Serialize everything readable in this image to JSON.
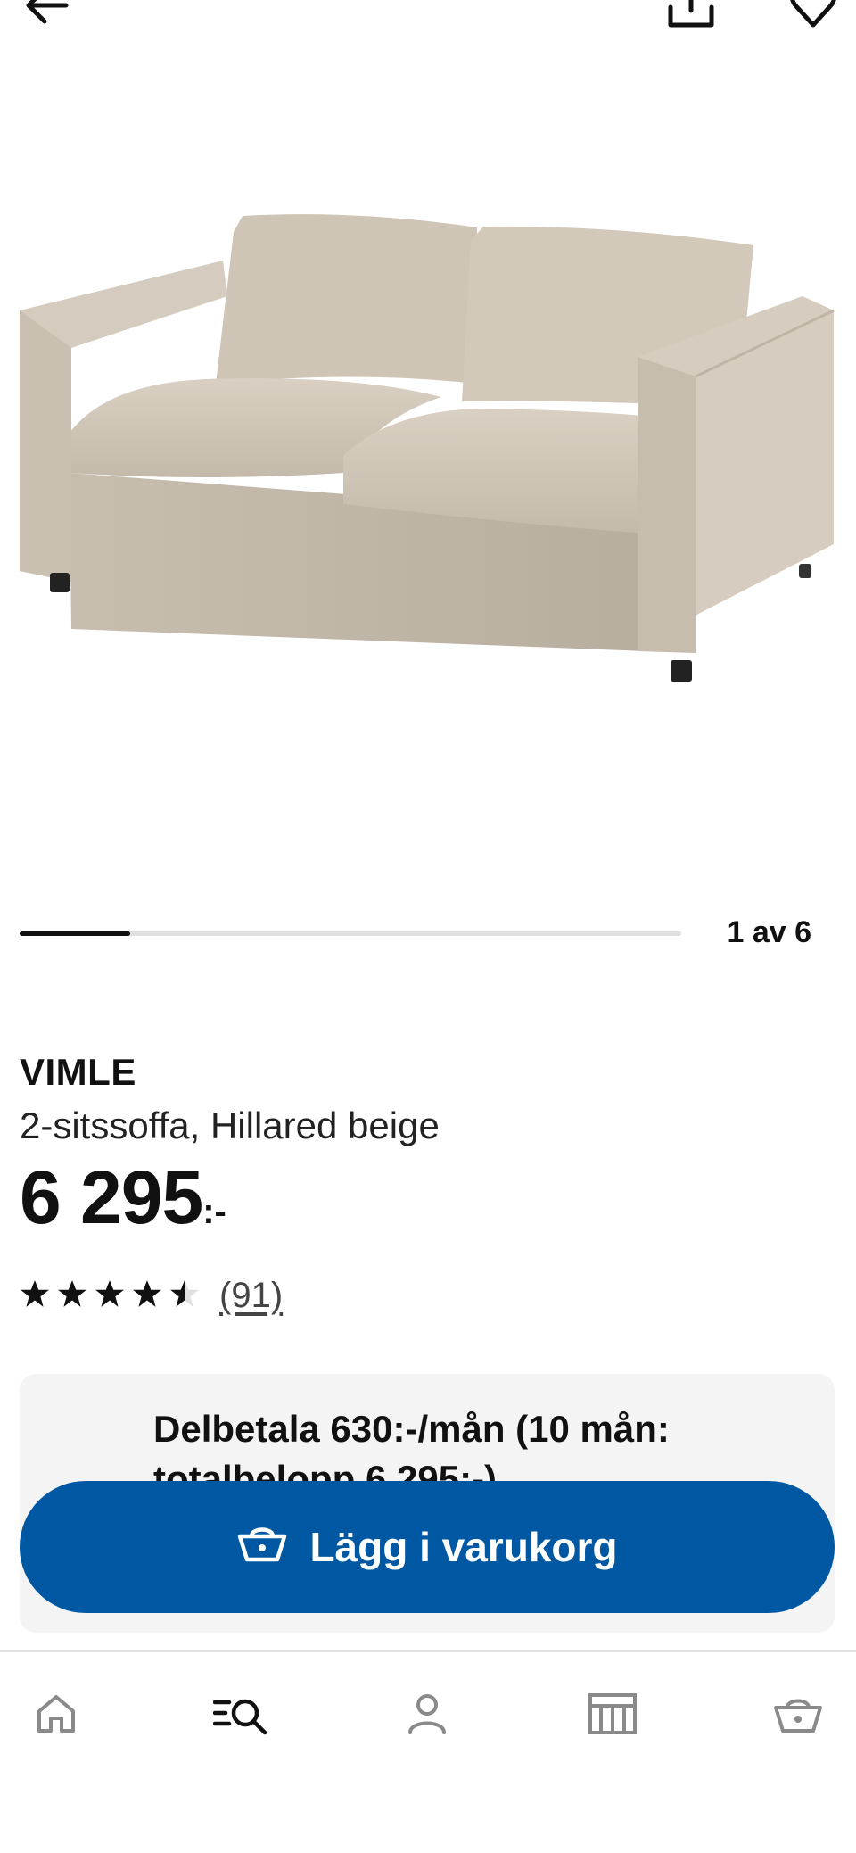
{
  "header": {
    "back_icon": "arrow-left-icon",
    "share_icon": "share-upload-icon",
    "favorite_icon": "heart-outline-icon"
  },
  "gallery": {
    "counter": "1 av 6",
    "current": 1,
    "total": 6,
    "image_alt": "2-sitssoffa"
  },
  "product": {
    "name": "VIMLE",
    "description": "2-sitssoffa, Hillared beige",
    "price": "6 295",
    "price_suffix": ":-",
    "rating": 4.5,
    "rating_max": 5,
    "review_count": "(91)"
  },
  "installment": {
    "text": "Delbetala 630:-/mån (10 mån: totalbelopp 6 295:-)"
  },
  "cart_button": {
    "label": "Lägg i varukorg",
    "icon": "basket-icon"
  },
  "bottom_nav": [
    {
      "name": "home",
      "icon": "home-icon"
    },
    {
      "name": "search",
      "icon": "search-list-icon",
      "active": true
    },
    {
      "name": "profile",
      "icon": "person-icon"
    },
    {
      "name": "store",
      "icon": "store-icon"
    },
    {
      "name": "cart",
      "icon": "basket-icon"
    }
  ],
  "colors": {
    "brand_blue": "#0058a3",
    "card_gray": "#f4f4f4",
    "text": "#111111",
    "icon_gray": "#8a8a8a"
  }
}
